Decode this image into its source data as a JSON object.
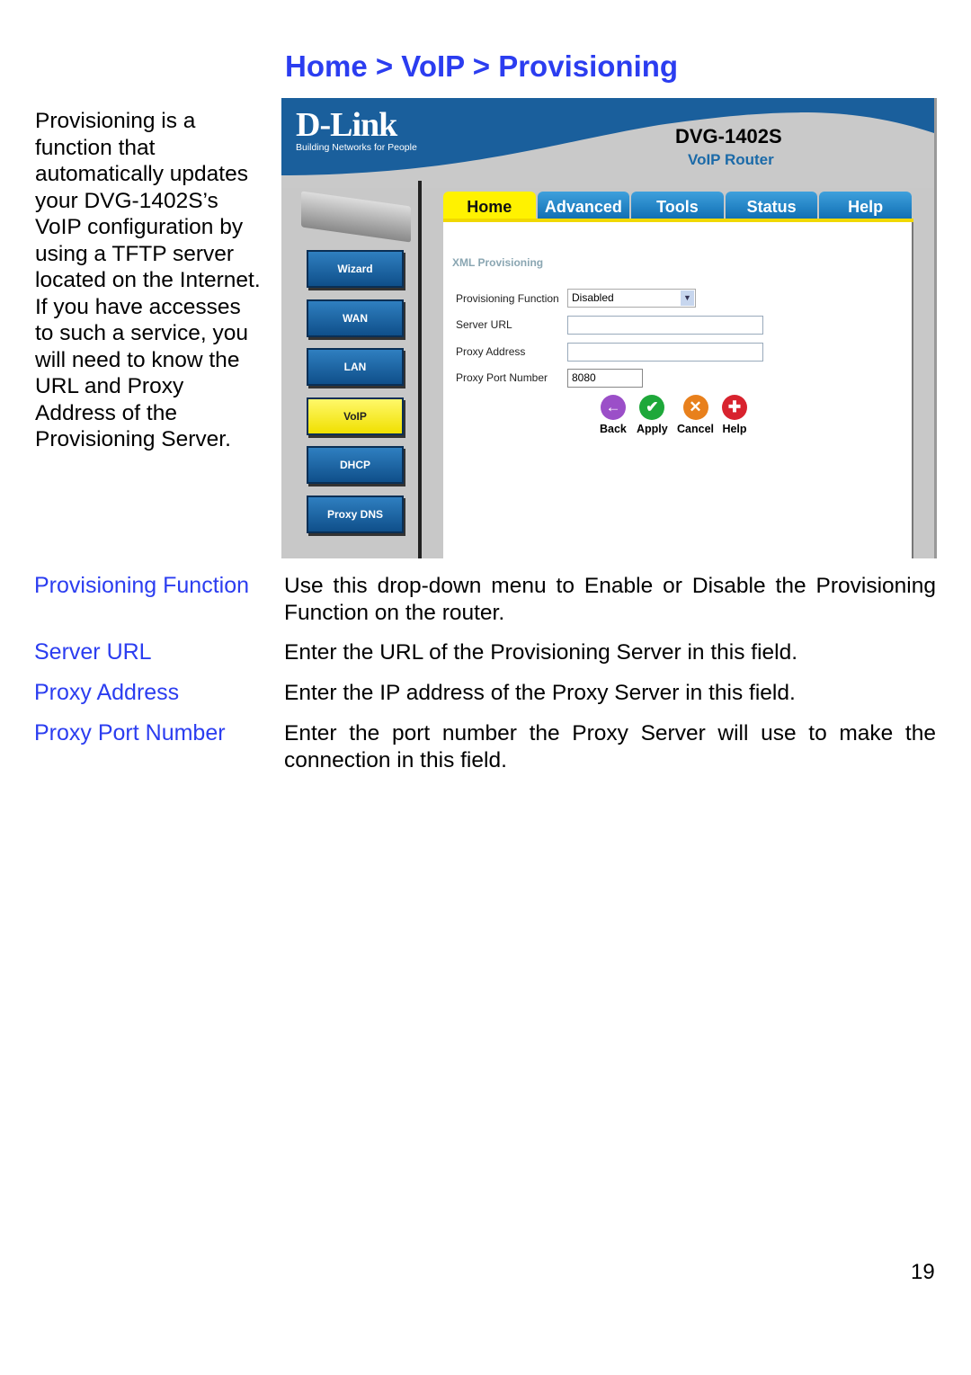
{
  "title": "Home > VoIP > Provisioning",
  "intro": "Provisioning is a function that automatically updates your DVG-1402S’s VoIP configuration by using a TFTP server located on the Internet.   If you have accesses to such a service, you will need to know the URL and Proxy Address of the Provisioning Server.",
  "screenshot": {
    "logo": "D-Link",
    "tagline": "Building Networks for People",
    "model": "DVG-1402S",
    "subtitle": "VoIP Router",
    "nav": [
      "Wizard",
      "WAN",
      "LAN",
      "VoIP",
      "DHCP",
      "Proxy DNS"
    ],
    "nav_active": "VoIP",
    "tabs": [
      "Home",
      "Advanced",
      "Tools",
      "Status",
      "Help"
    ],
    "tab_active": "Home",
    "section": "XML Provisioning",
    "fields": {
      "provisioning_function": {
        "label": "Provisioning Function",
        "value": "Disabled"
      },
      "server_url": {
        "label": "Server URL",
        "value": ""
      },
      "proxy_address": {
        "label": "Proxy Address",
        "value": ""
      },
      "proxy_port": {
        "label": "Proxy Port Number",
        "value": "8080"
      }
    },
    "buttons": {
      "back": "Back",
      "apply": "Apply",
      "cancel": "Cancel",
      "help": "Help"
    }
  },
  "definitions": [
    {
      "term": "Provisioning Function",
      "text": "Use this drop-down menu to Enable or Disable the Provisioning Function on the router."
    },
    {
      "term": "Server URL",
      "text": "Enter the URL of the Provisioning Server in this field."
    },
    {
      "term": "Proxy Address",
      "text": "Enter the IP address of the Proxy Server in this field."
    },
    {
      "term": "Proxy Port Number",
      "text": "Enter the port number the Proxy Server will use to make the connection in this field."
    }
  ],
  "page_number": "19",
  "colors": {
    "heading": "#2b3df0",
    "header_blue": "#1a5f9c",
    "active_yellow": "#fff200"
  }
}
